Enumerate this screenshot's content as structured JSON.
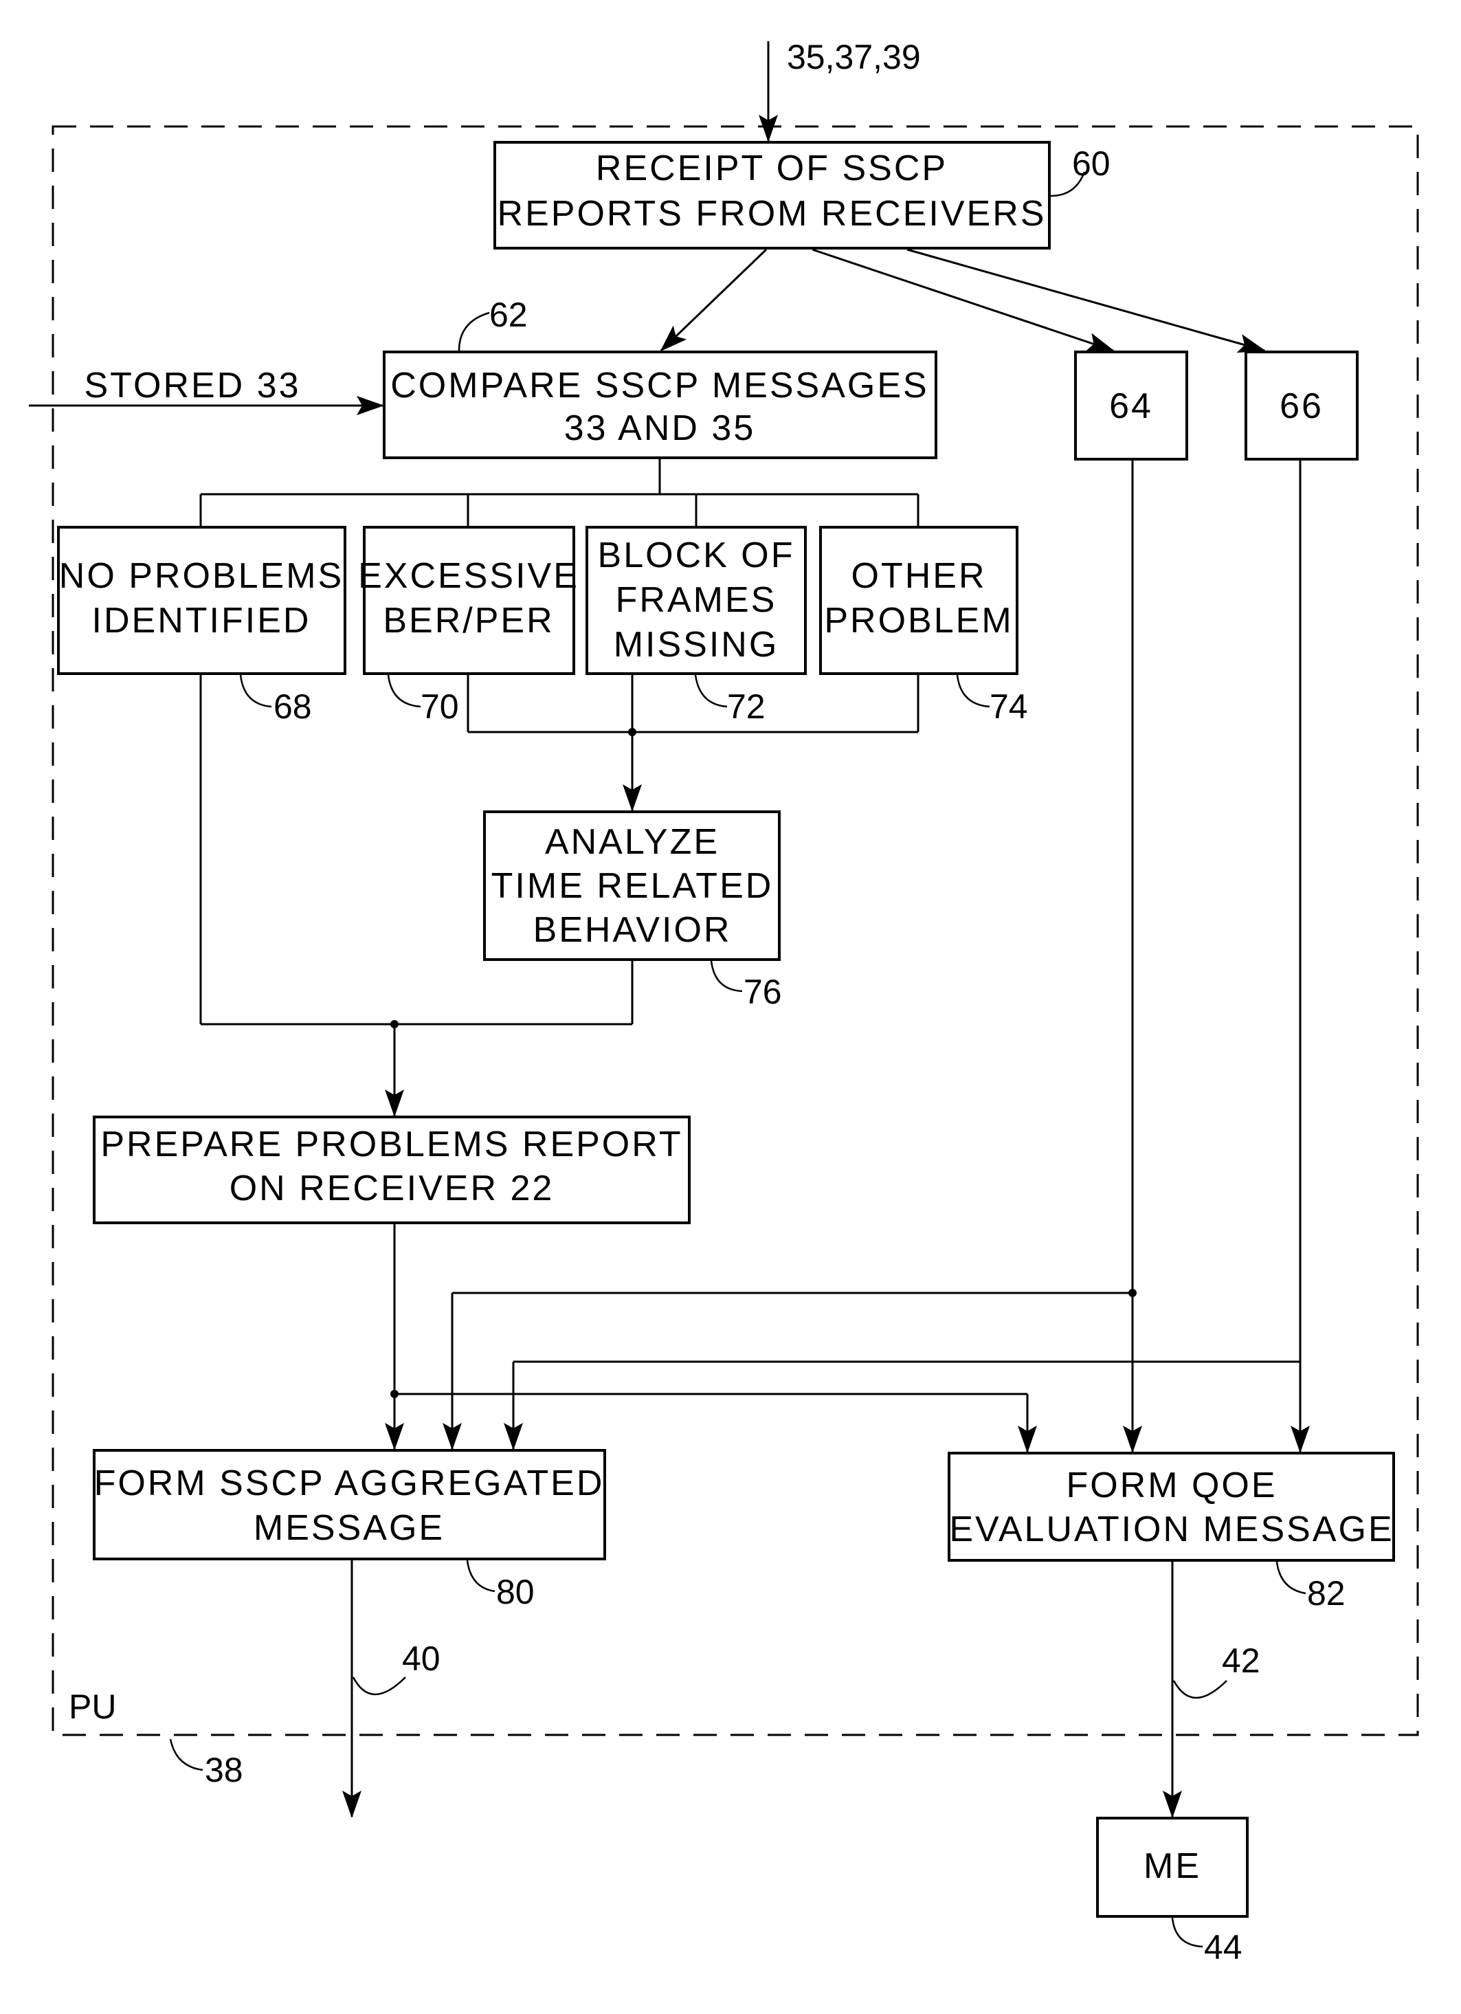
{
  "diagram": {
    "input_label": "35,37,39",
    "unit_label": "PU",
    "unit_ref": "38",
    "stored_label": "STORED 33",
    "boxes": {
      "receipt": {
        "lines": [
          "RECEIPT OF SSCP",
          "REPORTS FROM RECEIVERS"
        ],
        "ref": "60"
      },
      "compare": {
        "lines": [
          "COMPARE SSCP MESSAGES",
          "33 AND 35"
        ],
        "ref": "62"
      },
      "box64": {
        "lines": [
          "64"
        ]
      },
      "box66": {
        "lines": [
          "66"
        ]
      },
      "no_problems": {
        "lines": [
          "NO PROBLEMS",
          "IDENTIFIED"
        ],
        "ref": "68"
      },
      "excessive": {
        "lines": [
          "EXCESSIVE",
          "BER/PER"
        ],
        "ref": "70"
      },
      "block_missing": {
        "lines": [
          "BLOCK OF",
          "FRAMES",
          "MISSING"
        ],
        "ref": "72"
      },
      "other": {
        "lines": [
          "OTHER",
          "PROBLEM"
        ],
        "ref": "74"
      },
      "analyze": {
        "lines": [
          "ANALYZE",
          "TIME RELATED",
          "BEHAVIOR"
        ],
        "ref": "76"
      },
      "prepare": {
        "lines": [
          "PREPARE PROBLEMS REPORT",
          "ON RECEIVER 22"
        ]
      },
      "aggregated": {
        "lines": [
          "FORM SSCP AGGREGATED",
          "MESSAGE"
        ],
        "ref": "80"
      },
      "qoe": {
        "lines": [
          "FORM QOE",
          "EVALUATION MESSAGE"
        ],
        "ref": "82"
      },
      "me": {
        "lines": [
          "ME"
        ],
        "ref": "44"
      }
    },
    "output_refs": {
      "aggregated_out": "40",
      "qoe_out": "42"
    }
  }
}
